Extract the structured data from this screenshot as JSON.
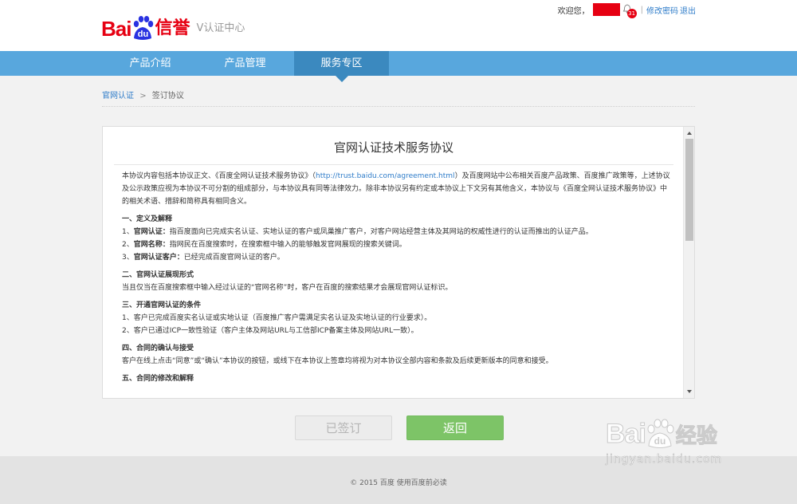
{
  "header": {
    "logo_bai": "Bai",
    "logo_du": "du",
    "logo_xinyu": "信誉",
    "logo_sub": "V认证中心",
    "welcome": "欢迎您，",
    "notification_count": "31",
    "separator": "|",
    "change_password": "修改密码",
    "logout": "退出"
  },
  "nav": {
    "items": [
      {
        "label": "产品介绍"
      },
      {
        "label": "产品管理"
      },
      {
        "label": "服务专区"
      }
    ],
    "active_index": 2
  },
  "breadcrumb": {
    "link": "官网认证",
    "arrow": ">",
    "current": "签订协议"
  },
  "agreement": {
    "title": "官网认证技术服务协议",
    "intro_pre": "本协议内容包括本协议正文、《百度全网认证技术服务协议》（",
    "intro_url": "http://trust.baidu.com/agreement.html",
    "intro_post": "）及百度网站中公布相关百度产品政策、百度推广政策等，上述协议及公示政策应视为本协议不可分割的组成部分，与本协议具有同等法律效力。除非本协议另有约定或本协议上下文另有其他含义，本协议与《百度全网认证技术服务协议》中的相关术语、措辞和简称具有相同含义。",
    "s1_title": "一、定义及解释",
    "s1_1_num": "1、",
    "s1_1_term": "官网认证：",
    "s1_1_text": "指百度面向已完成实名认证、实地认证的客户或凤巢推广客户，对客户网站经营主体及其网站的权威性进行的认证而推出的认证产品。",
    "s1_2_num": "2、",
    "s1_2_term": "官网名称：",
    "s1_2_text": "指网民在百度搜索时，在搜索框中输入的能够触发官网展现的搜索关键词。",
    "s1_3_num": "3、",
    "s1_3_term": "官网认证客户：",
    "s1_3_text": "已经完成百度官网认证的客户。",
    "s2_title": "二、官网认证展现形式",
    "s2_text": "当且仅当在百度搜索框中输入经过认证的“官网名称”时，客户在百度的搜索结果才会展现官网认证标识。",
    "s3_title": "三、开通官网认证的条件",
    "s3_1": "1、客户已完成百度实名认证或实地认证（百度推广客户需满足实名认证及实地认证的行业要求）。",
    "s3_2": "2、客户已通过ICP一致性验证（客户主体及网站URL与工信部ICP备案主体及网站URL一致）。",
    "s4_title": "四、合同的确认与接受",
    "s4_text": "客户在线上点击“同意”或“确认”本协议的按钮，或线下在本协议上签章均将视为对本协议全部内容和条款及后续更新版本的同意和接受。",
    "s5_title": "五、合同的修改和解释"
  },
  "buttons": {
    "signed": "已签订",
    "back": "返回"
  },
  "footer": {
    "text": "© 2015 百度 使用百度前必读"
  },
  "watermark": {
    "bai": "Bai",
    "du": "du",
    "jingyan": "经验",
    "url": "jingyan.baidu.com"
  },
  "colors": {
    "brand_red": "#e60012",
    "nav_blue": "#58a7dd",
    "nav_active": "#3b89bf",
    "link_blue": "#2e7cc9",
    "back_green": "#7dc467"
  }
}
